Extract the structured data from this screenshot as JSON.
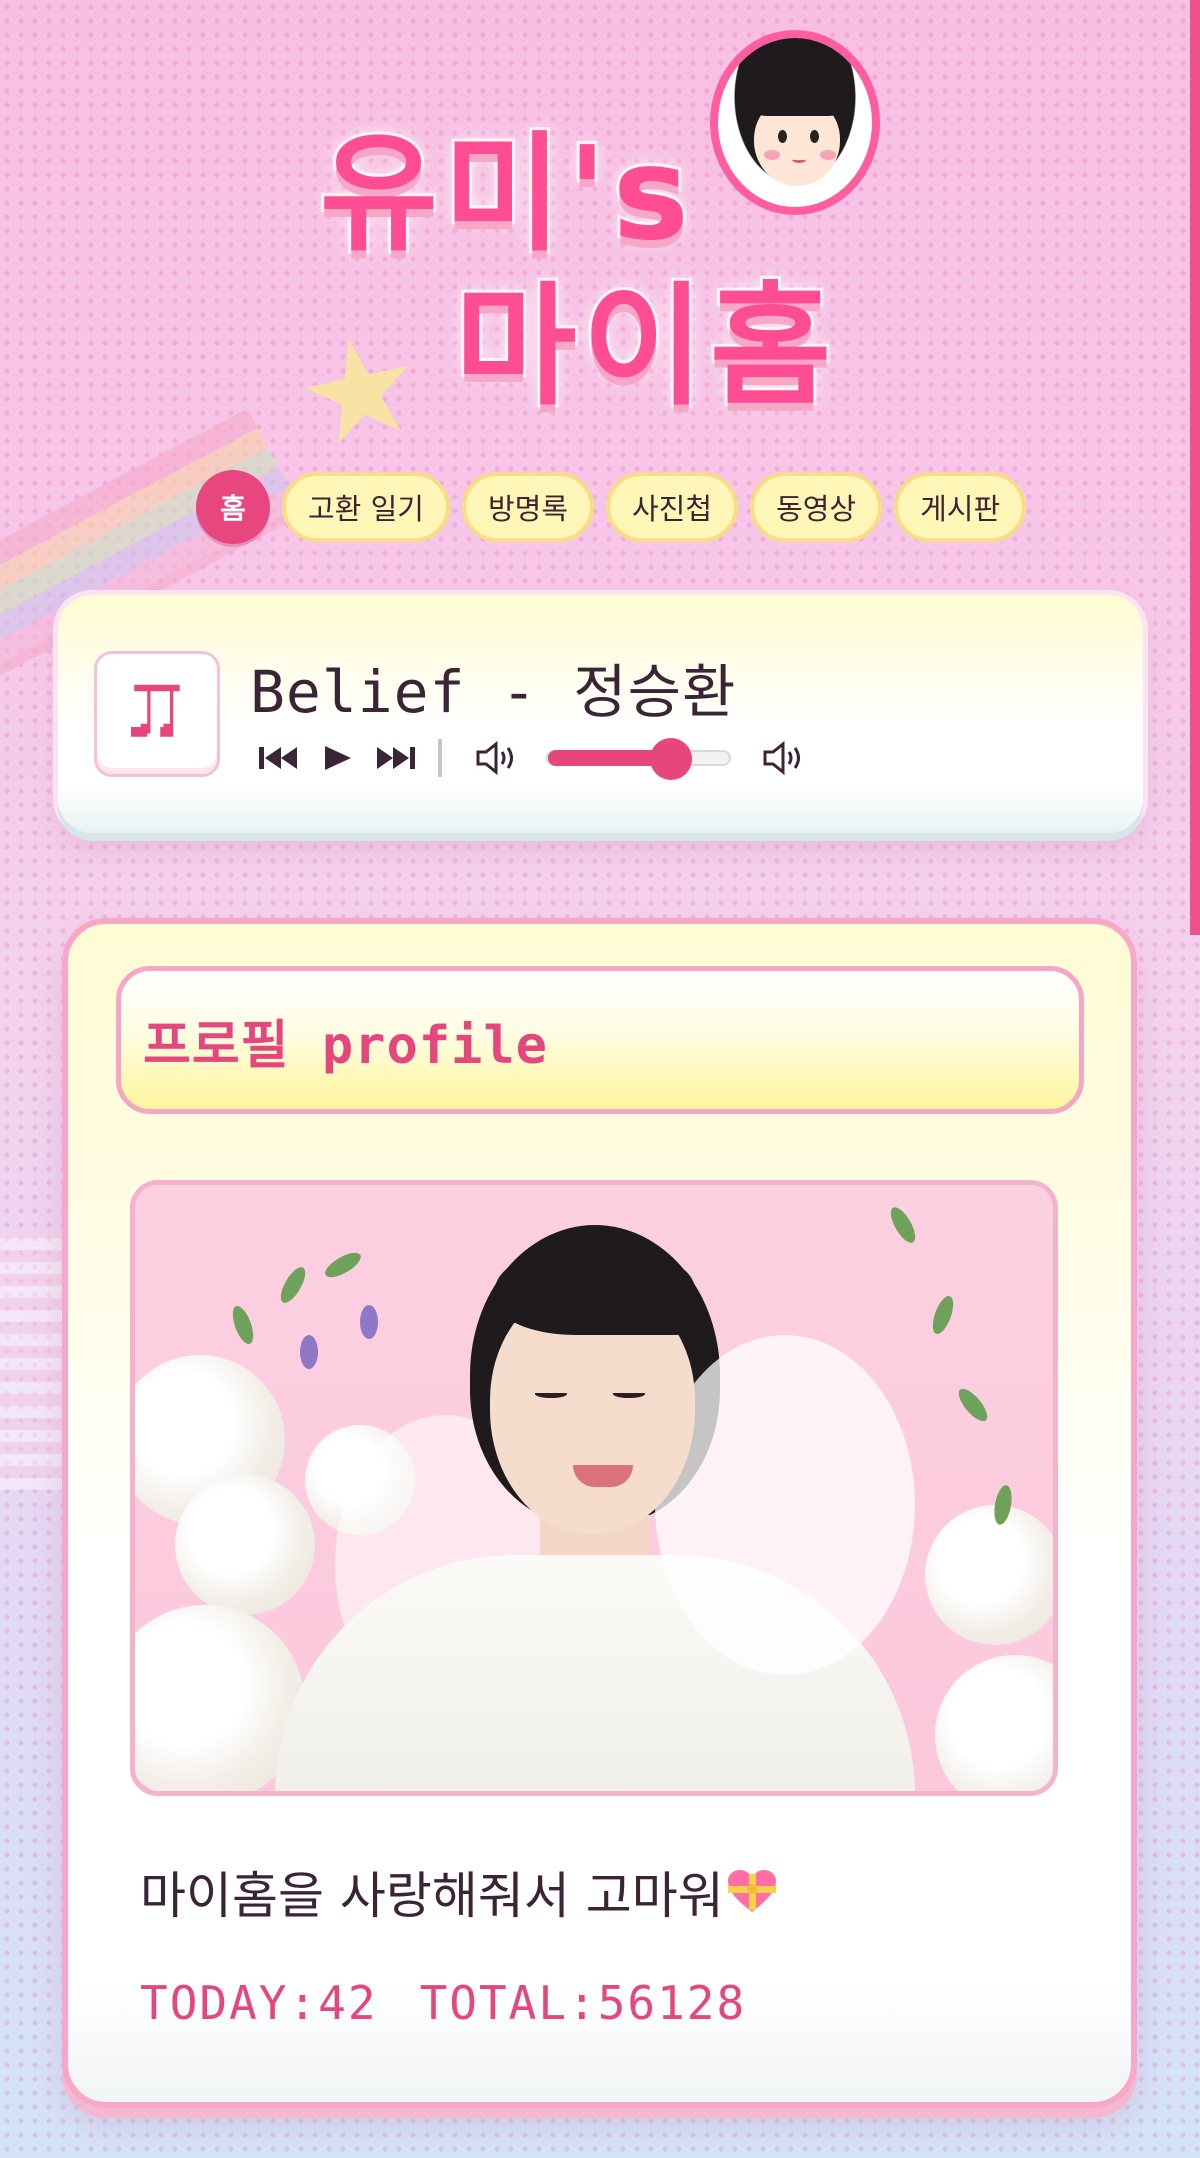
{
  "site": {
    "logo_line1": "유미's",
    "logo_line2": "마이홈"
  },
  "nav": {
    "items": [
      {
        "label": "홈",
        "active": true
      },
      {
        "label": "고환 일기",
        "active": false
      },
      {
        "label": "방명록",
        "active": false
      },
      {
        "label": "사진첩",
        "active": false
      },
      {
        "label": "동영상",
        "active": false
      },
      {
        "label": "게시판",
        "active": false
      }
    ]
  },
  "player": {
    "album_icon": "music-note-icon",
    "song_title": "Belief - 정승환",
    "volume_percent": 68,
    "controls": [
      "previous-icon",
      "play-icon",
      "next-icon",
      "volume-low-icon",
      "volume-high-icon"
    ]
  },
  "profile": {
    "title": "프로필 profile",
    "message": "마이홈을 사랑해줘서 고마워",
    "message_emoji": "heart-ribbon-icon",
    "today_label": "TODAY:42",
    "total_label": "TOTAL:56128"
  },
  "colors": {
    "accent": "#e6467c",
    "pill_bg": "#fff6b8",
    "pill_border": "#f7dd86",
    "card_border": "#f7a8c8",
    "text_dark": "#3b2435"
  }
}
